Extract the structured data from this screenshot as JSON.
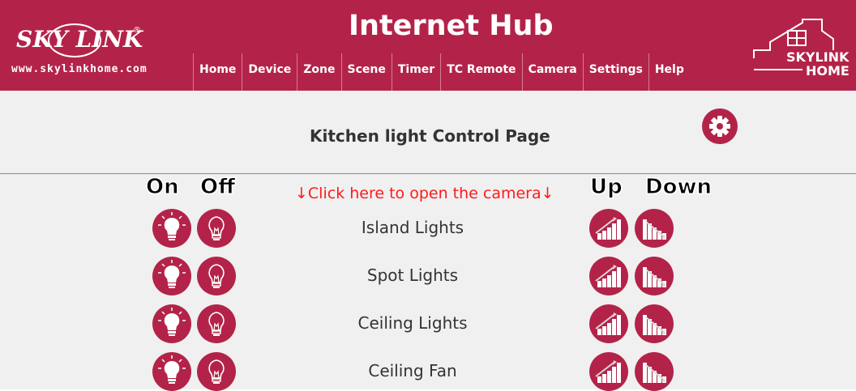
{
  "header": {
    "brand": "SKY LINK",
    "url": "www.skylinkhome.com",
    "title": "Internet Hub",
    "home_logo_top": "SKYLINK",
    "home_logo_bottom": "HOME"
  },
  "nav": [
    "Home",
    "Device",
    "Zone",
    "Scene",
    "Timer",
    "TC Remote",
    "Camera",
    "Settings",
    "Help"
  ],
  "page": {
    "title": "Kitchen light Control Page",
    "camera_link": "↓Click here to open the camera↓"
  },
  "columns": {
    "on": "On",
    "off": "Off",
    "up": "Up",
    "down": "Down"
  },
  "devices": [
    {
      "name": "Island Lights"
    },
    {
      "name": "Spot Lights"
    },
    {
      "name": "Ceiling Lights"
    },
    {
      "name": "Ceiling Fan"
    }
  ],
  "colors": {
    "brand": "#b32349",
    "background": "#f0f0f0",
    "link": "#ff1a1a"
  },
  "icons": {
    "settings": "gear-icon",
    "on": "bulb-on-icon",
    "off": "bulb-off-icon",
    "up": "brightness-up-icon",
    "down": "brightness-down-icon"
  }
}
